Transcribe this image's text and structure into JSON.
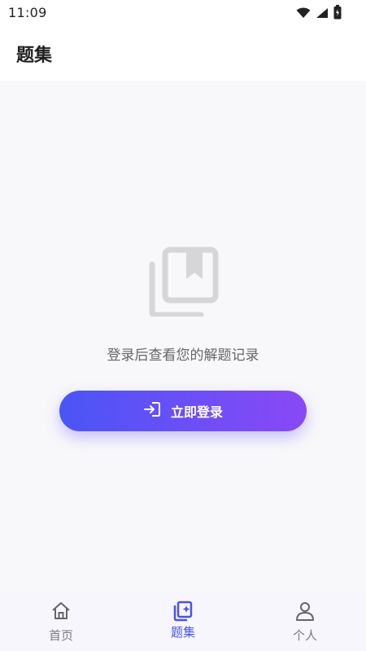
{
  "status_bar": {
    "time": "11:09",
    "icons": [
      "wifi-icon",
      "signal-icon",
      "battery-icon"
    ]
  },
  "header": {
    "title": "题集"
  },
  "empty_state": {
    "icon": "bookmark-book-icon",
    "message": "登录后查看您的解题记录"
  },
  "login_button": {
    "icon": "login-icon",
    "label": "立即登录",
    "gradient": [
      "#4a55f5",
      "#8a48f6"
    ]
  },
  "tabbar": {
    "items": [
      {
        "label": "首页",
        "icon": "home-icon",
        "active": false
      },
      {
        "label": "题集",
        "icon": "question-set-icon",
        "active": true
      },
      {
        "label": "个人",
        "icon": "person-icon",
        "active": false
      }
    ],
    "active_color": "#4b52e8"
  }
}
